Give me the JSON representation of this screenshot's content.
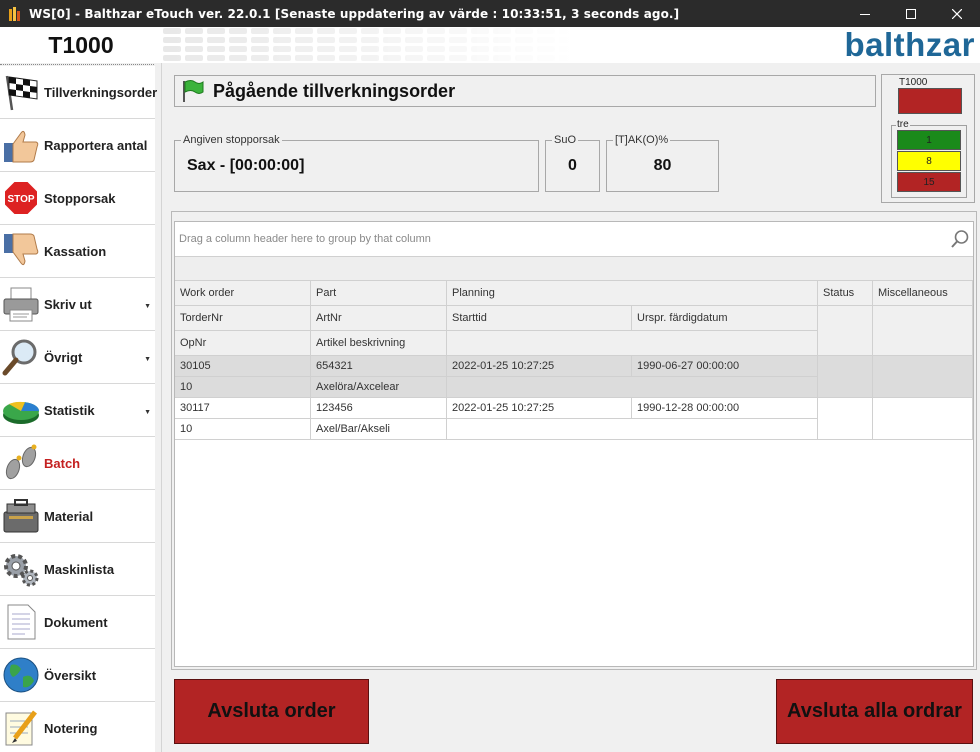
{
  "titlebar": {
    "title": "WS[0] - Balthzar eTouch ver. 22.0.1  [Senaste uppdatering av värde : 10:33:51, 3 seconds ago.]"
  },
  "header": {
    "machine_name": "T1000",
    "logo_text": "balthzar"
  },
  "sidebar": {
    "items": [
      {
        "label": "Tillverkningsorder",
        "icon": "checkered-flag-icon"
      },
      {
        "label": "Rapportera antal",
        "icon": "thumbs-up-icon"
      },
      {
        "label": "Stopporsak",
        "icon": "stop-sign-icon"
      },
      {
        "label": "Kassation",
        "icon": "thumbs-down-icon"
      },
      {
        "label": "Skriv ut",
        "icon": "printer-icon",
        "arrow": "▼"
      },
      {
        "label": "Övrigt",
        "icon": "magnifier-icon",
        "arrow": "▼"
      },
      {
        "label": "Statistik",
        "icon": "pie-chart-icon",
        "arrow": "▼"
      },
      {
        "label": "Batch",
        "icon": "footprints-icon"
      },
      {
        "label": "Material",
        "icon": "toolbox-icon"
      },
      {
        "label": "Maskinlista",
        "icon": "gears-icon"
      },
      {
        "label": "Dokument",
        "icon": "document-icon"
      },
      {
        "label": "Översikt",
        "icon": "globe-icon"
      },
      {
        "label": "Notering",
        "icon": "notepad-pencil-icon"
      }
    ],
    "active_index": 7,
    "active_color": "#c42121"
  },
  "main": {
    "title": "Pågående tillverkningsorder",
    "stop_reason": {
      "label": "Angiven stopporsak",
      "value": "Sax - [00:00:00]"
    },
    "suo": {
      "label": "SuO",
      "value": "0"
    },
    "takt": {
      "label": "[T]AK(O)%",
      "value": "80"
    }
  },
  "status_panel": {
    "machine_box": {
      "label": "T1000",
      "color": "#b22424"
    },
    "tre_box": {
      "label": "tre",
      "cells": [
        {
          "value": "1",
          "color": "#1a8a1a"
        },
        {
          "value": "8",
          "color": "#ffff00"
        },
        {
          "value": "15",
          "color": "#b22424"
        }
      ]
    }
  },
  "grid": {
    "group_hint": "Drag a column header here to group by that column",
    "headers": {
      "work_order": "Work order",
      "part": "Part",
      "planning": "Planning",
      "status": "Status",
      "misc": "Miscellaneous",
      "torder_nr": "TorderNr",
      "art_nr": "ArtNr",
      "starttid": "Starttid",
      "urspr": "Urspr. färdigdatum",
      "op_nr": "OpNr",
      "artikel": "Artikel beskrivning"
    },
    "rows": [
      {
        "torder_nr": "30105",
        "art_nr": "654321",
        "starttid": "2022-01-25 10:27:25",
        "urspr": "1990-06-27 00:00:00",
        "op_nr": "10",
        "artikel": "Axelöra/Axcelear"
      },
      {
        "torder_nr": "30117",
        "art_nr": "123456",
        "starttid": "2022-01-25 10:27:25",
        "urspr": "1990-12-28 00:00:00",
        "op_nr": "10",
        "artikel": "Axel/Bar/Akseli"
      }
    ]
  },
  "buttons": {
    "end_order": "Avsluta order",
    "end_all": "Avsluta alla ordrar"
  }
}
